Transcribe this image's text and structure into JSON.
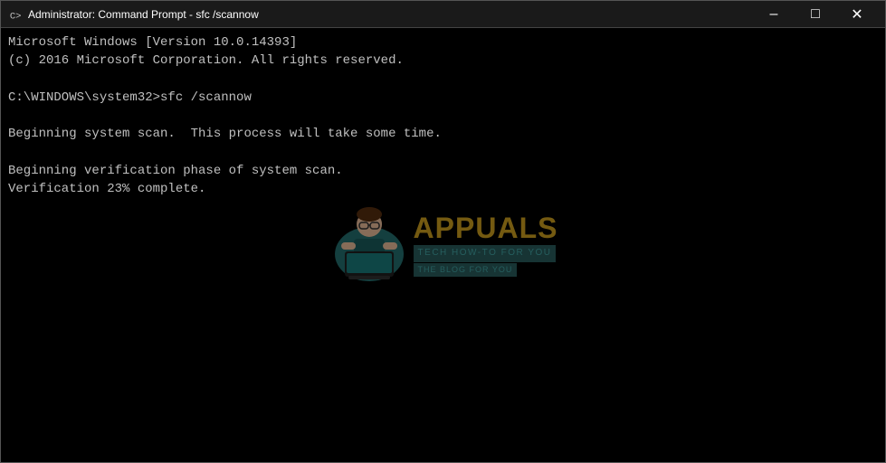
{
  "titleBar": {
    "icon": "cmd-icon",
    "title": "Administrator: Command Prompt - sfc  /scannow",
    "minimizeLabel": "–",
    "maximizeLabel": "□",
    "closeLabel": "✕"
  },
  "console": {
    "lines": [
      "Microsoft Windows [Version 10.0.14393]",
      "(c) 2016 Microsoft Corporation. All rights reserved.",
      "",
      "C:\\WINDOWS\\system32>sfc /scannow",
      "",
      "Beginning system scan.  This process will take some time.",
      "",
      "Beginning verification phase of system scan.",
      "Verification 23% complete.",
      "",
      "",
      "",
      "",
      "",
      "",
      "",
      "",
      "",
      "",
      "",
      "",
      ""
    ]
  },
  "watermark": {
    "brand": "APPUALS",
    "sub": "TECH HOW-TO FOR YOU",
    "tagline": "THE BLOG FOR YOU"
  }
}
